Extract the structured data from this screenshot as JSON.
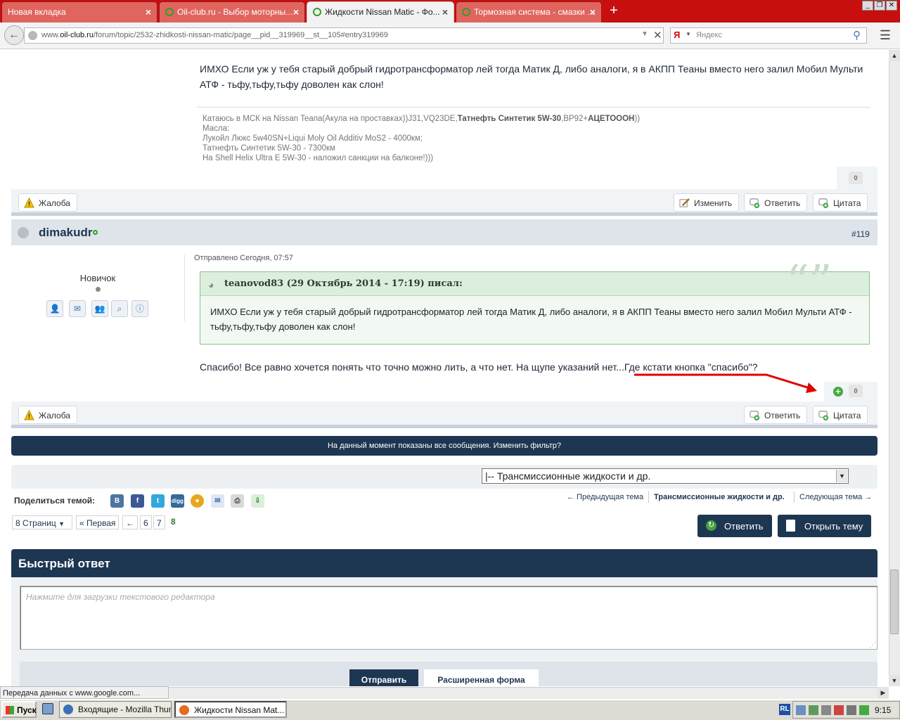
{
  "tabs": [
    {
      "title": "Новая вкладка"
    },
    {
      "title": "Oil-club.ru - Выбор моторны..."
    },
    {
      "title": "Жидкости Nissan Matic - Фо..."
    },
    {
      "title": "Тормозная система - смазки ..."
    }
  ],
  "address": {
    "prefix": "www.",
    "domain": "oil-club.ru",
    "path": "/forum/topic/2532-zhidkosti-nissan-matic/page__pid__319969__st__105#entry319969"
  },
  "search": {
    "placeholder": "Яндекс",
    "engine_mark": "Я"
  },
  "post1": {
    "text": "ИМХО Если уж у тебя старый добрый гидротрансформатор лей тогда Матик Д, либо аналоги, я в АКПП Теаны вместо него залил Мобил Мульти АТФ - тьфу,тьфу,тьфу доволен как слон!",
    "sig_line1_a": "Катаюсь в МСК на Nissan Teana(Акула на проставках))J31,VQ23DE,",
    "sig_line1_b": "Татнефть Синтетик 5W-30",
    "sig_line1_c": ",ВР92+",
    "sig_line1_d": "АЦЕТОООН",
    "sig_line1_e": "))",
    "sig_line2": "Масла:",
    "sig_line3": "Лукойл Люкс 5w40SN+Liqui Moly Oil Additiv MoS2 - 4000км;",
    "sig_line4": "Татнефть Синтетик 5W-30 - 7300км",
    "sig_line5": "На Shell Helix Ultra E 5W-30 - наложил санкции на балконе!)))",
    "rep": "0"
  },
  "actions1": {
    "report": "Жалоба",
    "edit": "Изменить",
    "reply": "Ответить",
    "quote": "Цитата"
  },
  "post2": {
    "author": "dimakudr",
    "number": "#119",
    "posted": "Отправлено Сегодня, 07:57",
    "rank": "Новичок",
    "quote_header": "teanovod83 (29 Октябрь 2014 - 17:19) писал:",
    "quote_text": "ИМХО Если уж у тебя старый добрый гидротрансформатор лей тогда Матик Д, либо аналоги, я в АКПП Теаны вместо него залил Мобил Мульти АТФ - тьфу,тьфу,тьфу доволен как слон!",
    "text": "Спасибо! Все равно хочется понять что точно можно лить, а что нет. На щупе указаний нет...Где кстати кнопка \"спасибо\"?",
    "rep": "0"
  },
  "actions2": {
    "report": "Жалоба",
    "reply": "Ответить",
    "quote": "Цитата"
  },
  "filter_bar": "На данный момент показаны все сообщения. Изменить фильтр?",
  "forum_select": "|-- Трансмиссионные жидкости и др.",
  "share_label": "Поделиться темой:",
  "topic_nav": {
    "prev": "← Предыдущая тема",
    "current": "Трансмиссионные жидкости и др.",
    "next": "Следующая тема →"
  },
  "pagination": {
    "pages": "8 Страниц",
    "first": "« Первая",
    "back": "←",
    "p6": "6",
    "p7": "7",
    "current": "8"
  },
  "buttons": {
    "reply": "Ответить",
    "open_topic": "Открыть тему"
  },
  "quick_reply": {
    "title": "Быстрый ответ",
    "placeholder": "Нажмите для загрузки текстового редактора",
    "send": "Отправить",
    "advanced": "Расширенная форма"
  },
  "status": "Передача данных с www.google.com...",
  "taskbar": {
    "start": "Пуск",
    "task1": "Входящие - Mozilla Thun...",
    "task2": "Жидкости Nissan Mat...",
    "lang": "RL",
    "time": "9:15"
  },
  "colors": {
    "accent": "#1d3652",
    "tabbar": "#c80f0f",
    "annotation": "#e00000"
  }
}
